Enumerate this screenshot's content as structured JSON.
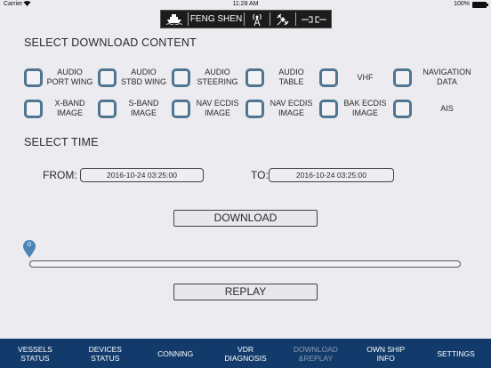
{
  "status_bar": {
    "carrier": "Carrier",
    "time": "11:28 AM",
    "battery": "100%"
  },
  "top_strip": {
    "ship_name": "FENG SHEN",
    "icons": [
      "ship-icon",
      "radio-tower-icon",
      "satellite-icon",
      "connection-icon"
    ]
  },
  "download_content": {
    "heading": "SELECT DOWNLOAD CONTENT",
    "options": [
      {
        "label": "AUDIO\nPORT WING",
        "checked": false
      },
      {
        "label": "AUDIO\nSTBD WING",
        "checked": false
      },
      {
        "label": "AUDIO\nSTEERING",
        "checked": false
      },
      {
        "label": "AUDIO\nTABLE",
        "checked": false
      },
      {
        "label": "VHF",
        "checked": false
      },
      {
        "label": "NAVIGATION\nDATA",
        "checked": false
      },
      {
        "label": "X-BAND\nIMAGE",
        "checked": false
      },
      {
        "label": "S-BAND\nIMAGE",
        "checked": false
      },
      {
        "label": "NAV ECDIS\nIMAGE",
        "checked": false
      },
      {
        "label": "NAV ECDIS\nIMAGE",
        "checked": false
      },
      {
        "label": "BAK ECDIS\nIMAGE",
        "checked": false
      },
      {
        "label": "AIS",
        "checked": false
      }
    ]
  },
  "select_time": {
    "heading": "SELECT TIME",
    "from_label": "FROM:",
    "from_value": "2016-10-24 03:25:00",
    "to_label": "TO:",
    "to_value": "2016-10-24 03:25:00"
  },
  "download_button": "DOWNLOAD",
  "progress": {
    "value_label": "0",
    "fraction": 0
  },
  "replay_button": "REPLAY",
  "tab_bar": {
    "active": "download_replay",
    "tabs": [
      {
        "id": "vessels_status",
        "label": "VESSELS\nSTATUS"
      },
      {
        "id": "devices_status",
        "label": "DEVICES\nSTATUS"
      },
      {
        "id": "conning",
        "label": "CONNING"
      },
      {
        "id": "vdr_diagnosis",
        "label": "VDR\nDIAGNOSIS"
      },
      {
        "id": "download_replay",
        "label": "DOWNLOAD\n&REPLAY"
      },
      {
        "id": "own_ship_info",
        "label": "OWN SHIP\nINFO"
      },
      {
        "id": "settings",
        "label": "SETTINGS"
      }
    ]
  },
  "colors": {
    "tab_bar_bg": "#123b6b",
    "checkbox_border": "#4f7590",
    "pin": "#4a85b9"
  }
}
